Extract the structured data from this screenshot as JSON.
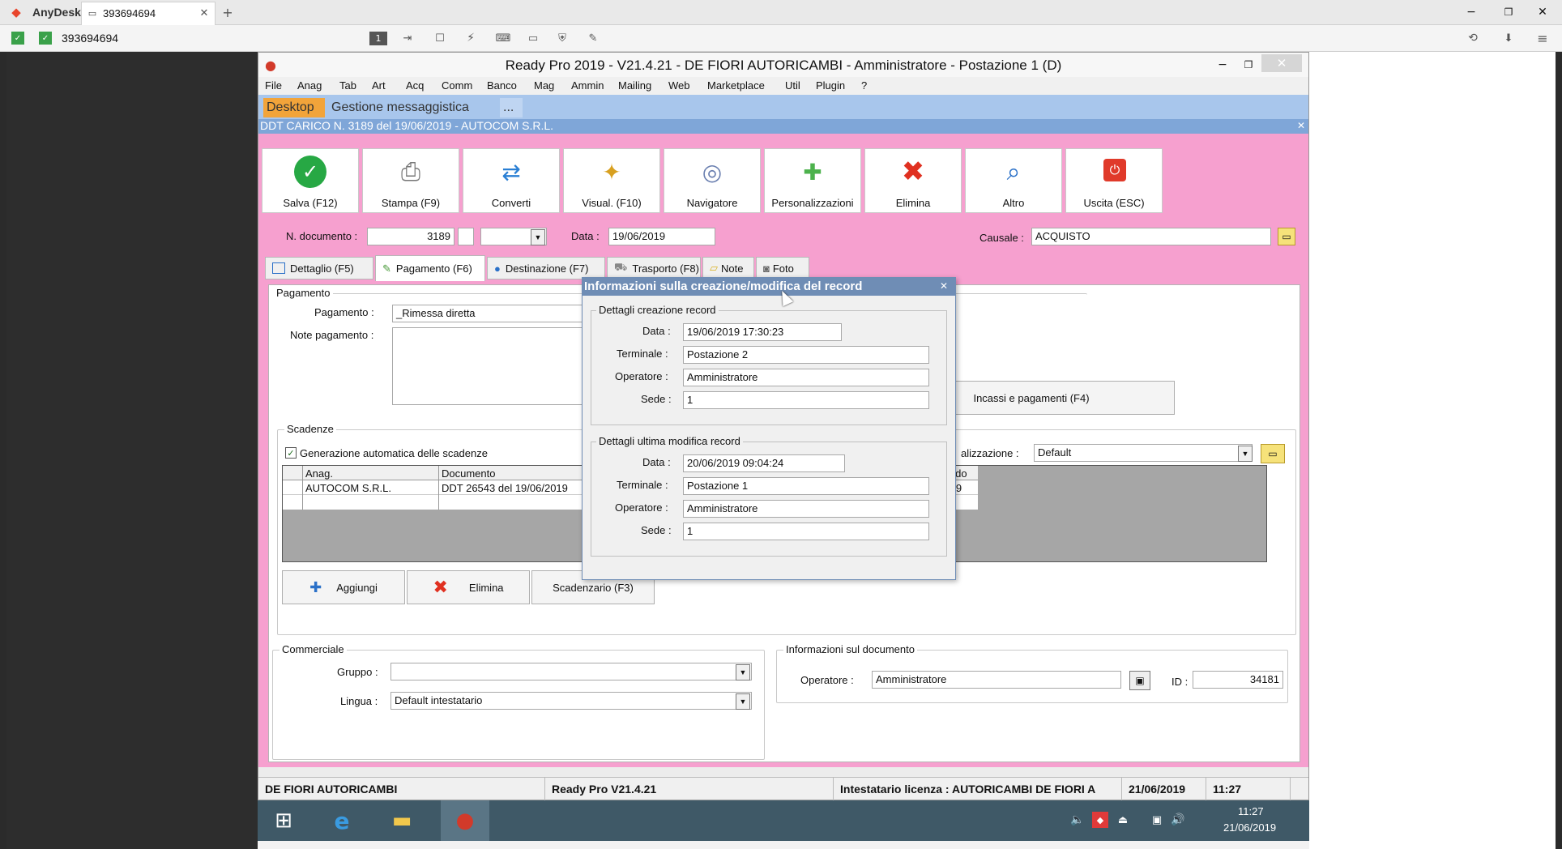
{
  "anydesk": {
    "app_name": "AnyDesk",
    "tab_label": "393694694",
    "address": "393694694"
  },
  "window": {
    "title": "Ready Pro 2019 - V21.4.21 - DE FIORI AUTORICAMBI - Amministratore - Postazione 1 (D)"
  },
  "menu": [
    "File",
    "Anag",
    "Tab",
    "Art",
    "Acq",
    "Comm",
    "Banco",
    "Mag",
    "Ammin",
    "Mailing",
    "Web",
    "Marketplace",
    "Util",
    "Plugin",
    "?"
  ],
  "tabs": [
    {
      "label": "Desktop"
    },
    {
      "label": "Gestione messaggistica"
    },
    {
      "label": "..."
    }
  ],
  "doc_title": "DDT CARICO N. 3189 del 19/06/2019 - AUTOCOM S.R.L.",
  "toolbar": [
    {
      "label": "Salva (F12)",
      "icon": "check-icon"
    },
    {
      "label": "Stampa (F9)",
      "icon": "printer-icon"
    },
    {
      "label": "Converti",
      "icon": "convert-icon"
    },
    {
      "label": "Visual. (F10)",
      "icon": "wand-icon"
    },
    {
      "label": "Navigatore",
      "icon": "compass-icon"
    },
    {
      "label": "Personalizzazioni",
      "icon": "puzzle-icon"
    },
    {
      "label": "Elimina",
      "icon": "delete-x-icon"
    },
    {
      "label": "Altro",
      "icon": "magnifier-icon"
    },
    {
      "label": "Uscita (ESC)",
      "icon": "exit-icon"
    }
  ],
  "header_fields": {
    "ndoc_label": "N. documento :",
    "ndoc_value": "3189",
    "data_label": "Data :",
    "data_value": "19/06/2019",
    "causale_label": "Causale :",
    "causale_value": "ACQUISTO"
  },
  "subtabs": [
    {
      "label": "Dettaglio (F5)"
    },
    {
      "label": "Pagamento (F6)"
    },
    {
      "label": "Destinazione (F7)"
    },
    {
      "label": "Trasporto (F8)"
    },
    {
      "label": "Note"
    },
    {
      "label": "Foto"
    }
  ],
  "pagamento": {
    "group_title": "Pagamento",
    "pagamento_label": "Pagamento :",
    "pagamento_value": "_Rimessa diretta",
    "note_label": "Note pagamento :",
    "incassi_button": "Incassi e pagamenti (F4)"
  },
  "scadenze": {
    "group_title": "Scadenze",
    "auto_label": "Generazione automatica delle scadenze",
    "personalizzazione_label": "alizzazione :",
    "personalizzazione_value": "Default",
    "columns": [
      "Anag.",
      "Documento",
      "aldo"
    ],
    "rows": [
      {
        "anag": "AUTOCOM S.R.L.",
        "documento": "DDT 26543 del 19/06/2019",
        "saldo": ",59"
      }
    ],
    "buttons": {
      "aggiungi": "Aggiungi",
      "elimina": "Elimina",
      "scadenzario": "Scadenzario (F3)"
    }
  },
  "commerciale": {
    "group_title": "Commerciale",
    "gruppo_label": "Gruppo :",
    "gruppo_value": "",
    "lingua_label": "Lingua :",
    "lingua_value": "Default intestatario"
  },
  "info_doc": {
    "group_title": "Informazioni sul documento",
    "operatore_label": "Operatore :",
    "operatore_value": "Amministratore",
    "id_label": "ID :",
    "id_value": "34181"
  },
  "dialog": {
    "title": "Informazioni sulla creazione/modifica del record",
    "creazione": {
      "title": "Dettagli creazione record",
      "data_label": "Data :",
      "data": "19/06/2019 17:30:23",
      "terminale_label": "Terminale :",
      "terminale": "Postazione 2",
      "operatore_label": "Operatore :",
      "operatore": "Amministratore",
      "sede_label": "Sede :",
      "sede": "1"
    },
    "modifica": {
      "title": "Dettagli ultima modifica record",
      "data_label": "Data :",
      "data": "20/06/2019 09:04:24",
      "terminale_label": "Terminale :",
      "terminale": "Postazione 1",
      "operatore_label": "Operatore :",
      "operatore": "Amministratore",
      "sede_label": "Sede :",
      "sede": "1"
    }
  },
  "statusbar": {
    "company": "DE FIORI AUTORICAMBI",
    "version": "Ready Pro V21.4.21",
    "license": "Intestatario licenza : AUTORICAMBI DE FIORI A",
    "date": "21/06/2019",
    "time": "11:27"
  },
  "taskbar": {
    "clock_time": "11:27",
    "clock_date": "21/06/2019"
  },
  "colors": {
    "pink": "#f6a0cf",
    "tabbar": "#a8c6ec",
    "doc_title": "#7fa6d8",
    "dialog_title": "#6f8db5"
  }
}
